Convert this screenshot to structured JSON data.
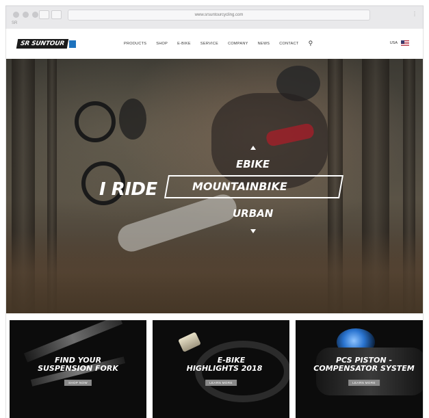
{
  "browser": {
    "url": "www.srsuntourcycling.com",
    "small_label": "SR"
  },
  "nav": {
    "logo_text": "SR SUNTOUR",
    "items": [
      "PRODUCTS",
      "SHOP",
      "E-BIKE",
      "SERVICE",
      "COMPANY",
      "NEWS",
      "CONTACT"
    ],
    "search_icon": "search-icon",
    "language": "USA",
    "flag": "us-flag-icon"
  },
  "hero": {
    "prefix": "I RIDE",
    "option_above": "EBIKE",
    "option_selected": "MOUNTAINBIKE",
    "option_below": "URBAN",
    "arrow_up": "▲",
    "arrow_down": "▼"
  },
  "tiles": [
    {
      "title_line1": "FIND YOUR",
      "title_line2": "SUSPENSION FORK",
      "button": "SHOP NOW"
    },
    {
      "title_line1": "E-BIKE",
      "title_line2": "HIGHLIGHTS 2018",
      "button": "LEARN MORE"
    },
    {
      "title_line1": "PCS PISTON -",
      "title_line2": "COMPENSATOR SYSTEM",
      "button": "LEARN MORE"
    }
  ],
  "colors": {
    "brand_blue": "#1e73be",
    "tile_bg": "#0c0c0c"
  }
}
